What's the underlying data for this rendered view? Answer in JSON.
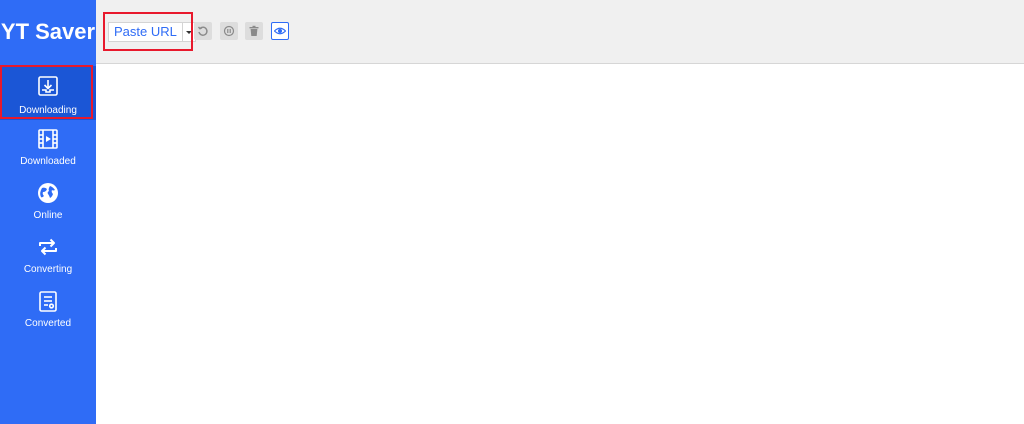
{
  "app": {
    "title": "YT Saver"
  },
  "sidebar": {
    "items": [
      {
        "label": "Downloading",
        "icon": "download-tray-icon",
        "active": true
      },
      {
        "label": "Downloaded",
        "icon": "film-strip-icon"
      },
      {
        "label": "Online",
        "icon": "globe-icon"
      },
      {
        "label": "Converting",
        "icon": "convert-arrows-icon"
      },
      {
        "label": "Converted",
        "icon": "document-icon"
      }
    ]
  },
  "toolbar": {
    "paste_url_label": "Paste URL",
    "buttons": [
      "refresh-icon",
      "pause-icon",
      "trash-icon",
      "eye-icon"
    ]
  },
  "colors": {
    "sidebar": "#2f6cf6",
    "sidebar_active": "#1b56d6",
    "toolbar": "#f0f0f0",
    "accent": "#2f6cf6",
    "highlight": "#e8192c"
  }
}
